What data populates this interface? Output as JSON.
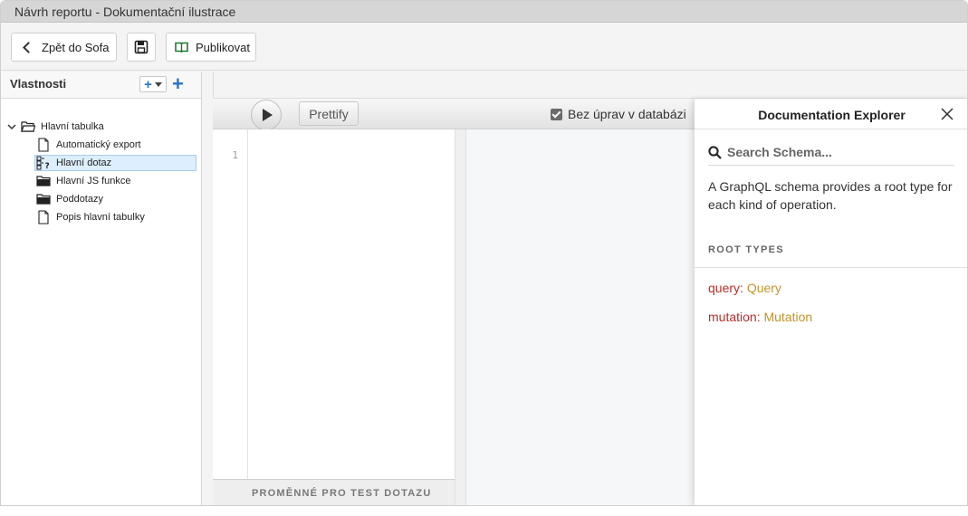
{
  "window": {
    "title": "Návrh reportu - Dokumentační ilustrace"
  },
  "toolbar": {
    "back_label": "Zpět do Sofa",
    "publish_label": "Publikovat"
  },
  "sidebar": {
    "title": "Vlastnosti",
    "add_symbol": "+",
    "add_big_symbol": "+",
    "tree": [
      {
        "label": "Hlavní tabulka",
        "icon": "folder-open-icon",
        "expanded": true
      },
      {
        "label": "Automatický export",
        "icon": "document-icon"
      },
      {
        "label": "Hlavní dotaz",
        "icon": "query-icon",
        "selected": true
      },
      {
        "label": "Hlavní JS funkce",
        "icon": "folder-icon"
      },
      {
        "label": "Poddotazy",
        "icon": "folder-icon"
      },
      {
        "label": "Popis hlavní tabulky",
        "icon": "document-icon"
      }
    ]
  },
  "editor": {
    "prettify_label": "Prettify",
    "no_db_changes_label": "Bez úprav v databázi",
    "no_db_changes_checked": true,
    "line_number": "1",
    "variables_label": "PROMĚNNÉ PRO TEST DOTAZU"
  },
  "docs": {
    "title": "Documentation Explorer",
    "search_placeholder": "Search Schema...",
    "description": "A GraphQL schema provides a root type for each kind of operation.",
    "section_title": "ROOT TYPES",
    "fields": [
      {
        "name": "query",
        "type": "Query"
      },
      {
        "name": "mutation",
        "type": "Mutation"
      }
    ]
  },
  "colors": {
    "accent_blue": "#2a73c8",
    "field_name": "#b3302c",
    "field_type": "#c0962a",
    "selection_bg": "#ddeeff"
  }
}
